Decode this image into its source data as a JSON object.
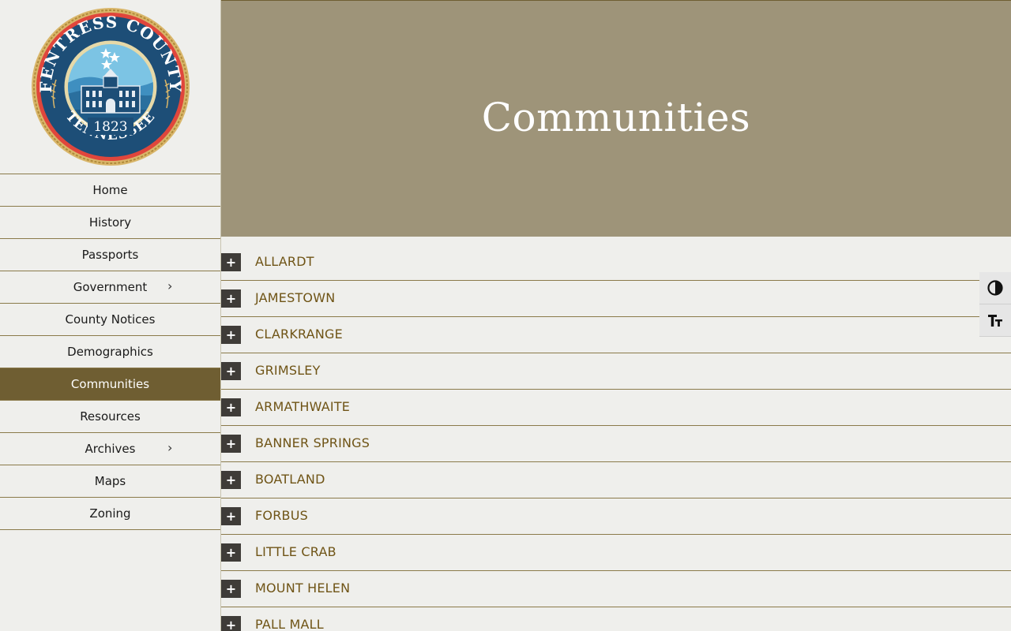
{
  "seal": {
    "top_text": "FENTRESS COUNTY",
    "bottom_text": "TENNESSEE",
    "year": "1823"
  },
  "nav": {
    "items": [
      {
        "label": "Home",
        "active": false,
        "has_submenu": false
      },
      {
        "label": "History",
        "active": false,
        "has_submenu": false
      },
      {
        "label": "Passports",
        "active": false,
        "has_submenu": false
      },
      {
        "label": "Government",
        "active": false,
        "has_submenu": true
      },
      {
        "label": "County Notices",
        "active": false,
        "has_submenu": false
      },
      {
        "label": "Demographics",
        "active": false,
        "has_submenu": false
      },
      {
        "label": "Communities",
        "active": true,
        "has_submenu": false
      },
      {
        "label": "Resources",
        "active": false,
        "has_submenu": false
      },
      {
        "label": "Archives",
        "active": false,
        "has_submenu": true
      },
      {
        "label": "Maps",
        "active": false,
        "has_submenu": false
      },
      {
        "label": "Zoning",
        "active": false,
        "has_submenu": false
      }
    ],
    "submenu_glyph": "›"
  },
  "hero": {
    "title": "Communities"
  },
  "accordion": {
    "toggle_glyph": "+",
    "items": [
      "ALLARDT",
      "JAMESTOWN",
      "CLARKRANGE",
      "GRIMSLEY",
      "ARMATHWAITE",
      "BANNER SPRINGS",
      "BOATLAND",
      "FORBUS",
      "LITTLE CRAB",
      "MOUNT HELEN",
      "PALL MALL"
    ]
  },
  "a11y": {
    "buttons": [
      {
        "icon": "contrast-icon"
      },
      {
        "icon": "font-size-icon"
      }
    ]
  },
  "colors": {
    "accent": "#6f5e32",
    "hero_bg": "#9e9479",
    "link": "#6f5416",
    "page_bg": "#efefec"
  }
}
